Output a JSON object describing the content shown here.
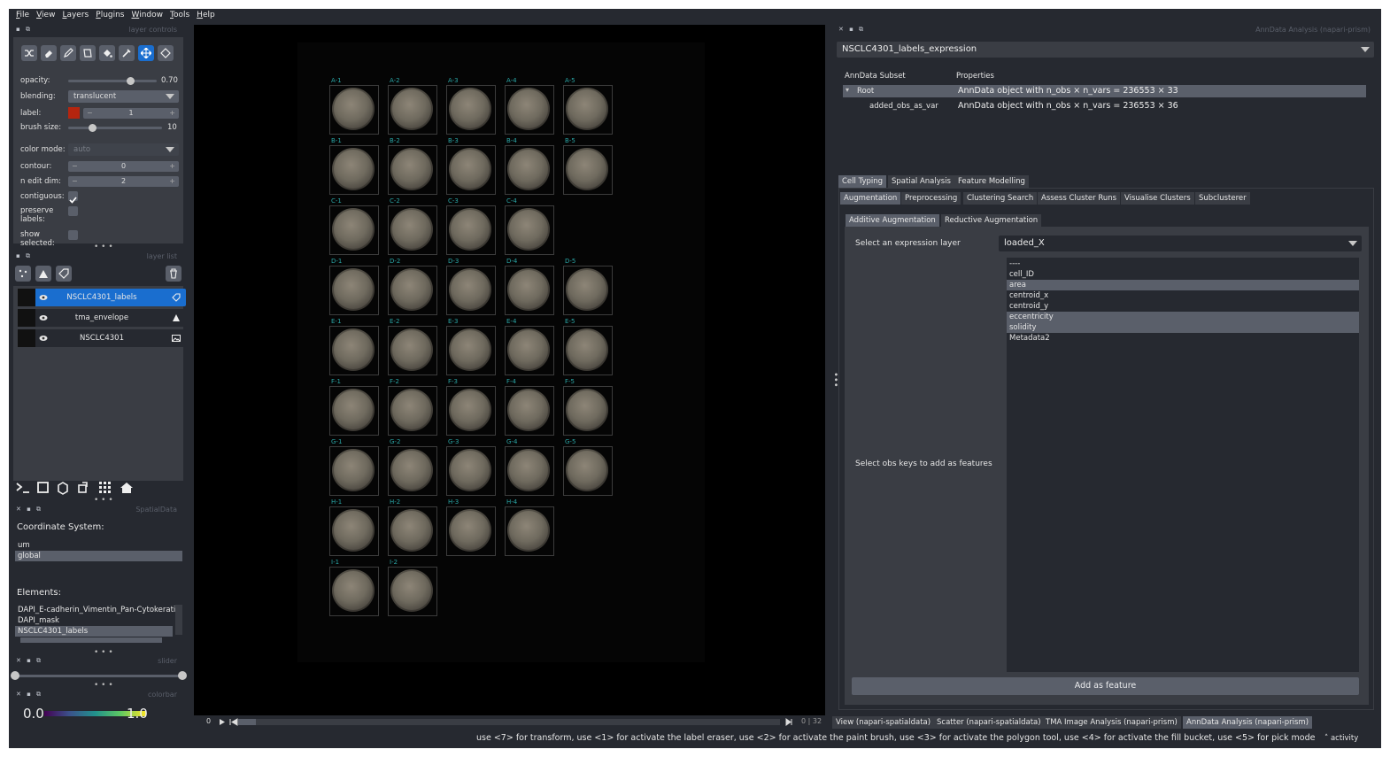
{
  "menu": [
    "File",
    "View",
    "Layers",
    "Plugins",
    "Window",
    "Tools",
    "Help"
  ],
  "left": {
    "layer_controls_title": "layer controls",
    "opacity_label": "opacity:",
    "opacity_value": "0.70",
    "opacity_fraction": 0.7,
    "blending_label": "blending:",
    "blending_value": "translucent",
    "label_label": "label:",
    "label_value": "1",
    "label_color": "#b5250f",
    "brush_label": "brush size:",
    "brush_value": "10",
    "brush_fraction": 0.25,
    "color_mode_label": "color mode:",
    "color_mode_value": "auto",
    "contour_label": "contour:",
    "contour_value": "0",
    "n_edit_label": "n edit dim:",
    "n_edit_value": "2",
    "contiguous_label": "contiguous:",
    "preserve_label_1": "preserve",
    "preserve_label_2": "labels:",
    "show_label_1": "show",
    "show_label_2": "selected:",
    "layer_list_title": "layer list",
    "layers": [
      {
        "name": "NSCLC4301_labels",
        "selected": true,
        "type_icon": "label-tag-icon"
      },
      {
        "name": "tma_envelope",
        "selected": false,
        "type_icon": "shapes-icon"
      },
      {
        "name": "NSCLC4301",
        "selected": false,
        "type_icon": "image-icon"
      }
    ],
    "spatialdata_title": "SpatialData",
    "coord_title": "Coordinate System:",
    "coord_items": [
      "um",
      "global"
    ],
    "coord_selected": "global",
    "elements_title": "Elements:",
    "elements": [
      "DAPI_E-cadherin_Vimentin_Pan-Cytokerati",
      "DAPI_mask",
      "NSCLC4301_labels"
    ],
    "elements_selected": "NSCLC4301_labels",
    "slider_title": "slider",
    "colorbar_title": "colorbar",
    "colorbar_min": "0.0",
    "colorbar_max": "1.0"
  },
  "canvas": {
    "cores": [
      [
        "A-1",
        "A-2",
        "A-3",
        "A-4",
        "A-5"
      ],
      [
        "B-1",
        "B-2",
        "B-3",
        "B-4",
        "B-5"
      ],
      [
        "C-1",
        "C-2",
        "C-3",
        "C-4",
        ""
      ],
      [
        "D-1",
        "D-2",
        "D-3",
        "D-4",
        "D-5"
      ],
      [
        "E-1",
        "E-2",
        "E-3",
        "E-4",
        "E-5"
      ],
      [
        "F-1",
        "F-2",
        "F-3",
        "F-4",
        "F-5"
      ],
      [
        "G-1",
        "G-2",
        "G-3",
        "G-4",
        "G-5"
      ],
      [
        "H-1",
        "H-2",
        "H-3",
        "H-4",
        ""
      ],
      [
        "I-1",
        "I-2",
        "",
        "",
        ""
      ]
    ],
    "dims_left": "0",
    "dims_right": "0 | 32"
  },
  "right": {
    "dock_title": "AnnData Analysis (napari-prism)",
    "dataset": "NSCLC4301_labels_expression",
    "tree_headers": [
      "AnnData Subset",
      "Properties"
    ],
    "tree_rows": [
      {
        "name": "Root",
        "props": "AnnData object with n_obs × n_vars = 236553 × 33",
        "selected": true
      },
      {
        "name": "added_obs_as_var",
        "props": "AnnData object with n_obs × n_vars = 236553 × 36",
        "selected": false
      }
    ],
    "main_tabs": [
      "Cell Typing",
      "Spatial Analysis",
      "Feature Modelling"
    ],
    "sub_tabs": [
      "Augmentation",
      "Preprocessing",
      "Clustering Search",
      "Assess Cluster Runs",
      "Visualise Clusters",
      "Subclusterer"
    ],
    "aug_tabs": [
      "Additive Augmentation",
      "Reductive Augmentation"
    ],
    "expr_label": "Select an expression layer",
    "expr_value": "loaded_X",
    "obs_label": "Select obs keys to add as features",
    "obs_keys": [
      {
        "key": "----",
        "selected": false
      },
      {
        "key": "cell_ID",
        "selected": false
      },
      {
        "key": "area",
        "selected": true
      },
      {
        "key": "centroid_x",
        "selected": false
      },
      {
        "key": "centroid_y",
        "selected": false
      },
      {
        "key": "eccentricity",
        "selected": true
      },
      {
        "key": "solidity",
        "selected": true
      },
      {
        "key": "Metadata2",
        "selected": false
      }
    ],
    "add_button": "Add as feature"
  },
  "bottom_tabs": [
    {
      "label": "View (napari-spatialdata)",
      "active": false
    },
    {
      "label": "Scatter (napari-spatialdata)",
      "active": false
    },
    {
      "label": "TMA Image Analysis (napari-prism)",
      "active": false
    },
    {
      "label": "AnnData Analysis (napari-prism)",
      "active": true
    }
  ],
  "status": {
    "message": "use <7> for transform, use <1> for activate the label eraser, use <2> for activate the paint brush, use <3> for activate the polygon tool, use <4> for activate the fill bucket, use <5> for pick mode",
    "activity": "activity"
  }
}
